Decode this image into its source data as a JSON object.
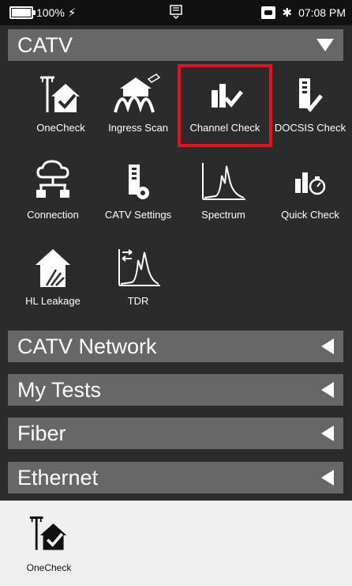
{
  "status_bar": {
    "battery": "100%",
    "time": "07:08 PM"
  },
  "sections": {
    "catv": {
      "label": "CATV"
    },
    "catv_network": {
      "label": "CATV Network"
    },
    "my_tests": {
      "label": "My Tests"
    },
    "fiber": {
      "label": "Fiber"
    },
    "ethernet": {
      "label": "Ethernet"
    }
  },
  "tiles": [
    {
      "label": "OneCheck",
      "icon": "onecheck-icon"
    },
    {
      "label": "Ingress Scan",
      "icon": "ingress-scan-icon"
    },
    {
      "label": "Channel Check",
      "icon": "channel-check-icon"
    },
    {
      "label": "DOCSIS Check",
      "icon": "docsis-check-icon"
    },
    {
      "label": "Connection",
      "icon": "connection-icon"
    },
    {
      "label": "CATV Settings",
      "icon": "catv-settings-icon"
    },
    {
      "label": "Spectrum",
      "icon": "spectrum-icon"
    },
    {
      "label": "Quick Check",
      "icon": "quick-check-icon"
    },
    {
      "label": "HL Leakage",
      "icon": "hl-leakage-icon"
    },
    {
      "label": "TDR",
      "icon": "tdr-icon"
    }
  ],
  "bottom": {
    "pinned": {
      "label": "OneCheck",
      "icon": "onecheck-icon"
    }
  },
  "colors": {
    "background": "#2b2b2b",
    "header": "#676767",
    "highlight": "#e8101d",
    "bottom_panel": "#efefef"
  }
}
